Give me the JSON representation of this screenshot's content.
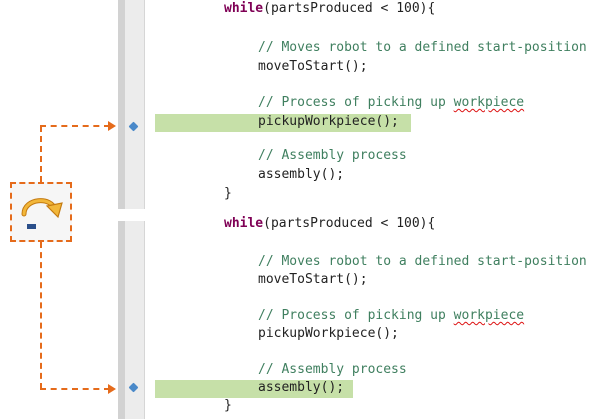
{
  "editor": {
    "top_panel": {
      "lines": [
        {
          "parts": [
            {
              "t": "while",
              "c": "kw"
            },
            {
              "t": "(partsProduced < 100){",
              "c": "plain"
            }
          ]
        },
        {
          "parts": [
            {
              "t": "// Moves robot to a defined start-position",
              "c": "comment"
            }
          ]
        },
        {
          "parts": [
            {
              "t": "moveToStart();",
              "c": "plain"
            }
          ]
        },
        {
          "parts": [
            {
              "t": "// Process of picking up ",
              "c": "comment"
            },
            {
              "t": "workpiece",
              "c": "comment squiggle"
            }
          ]
        },
        {
          "parts": [
            {
              "t": "pickupWorkpiece();",
              "c": "plain"
            }
          ]
        },
        {
          "parts": [
            {
              "t": "// Assembly process",
              "c": "comment"
            }
          ]
        },
        {
          "parts": [
            {
              "t": "assembly();",
              "c": "plain"
            }
          ]
        },
        {
          "parts": [
            {
              "t": "}",
              "c": "plain"
            }
          ]
        }
      ],
      "highlighted_line": "pickupWorkpiece();"
    },
    "bottom_panel": {
      "lines": [
        {
          "parts": [
            {
              "t": "while",
              "c": "kw"
            },
            {
              "t": "(partsProduced < 100){",
              "c": "plain"
            }
          ]
        },
        {
          "parts": [
            {
              "t": "// Moves robot to a defined start-position",
              "c": "comment"
            }
          ]
        },
        {
          "parts": [
            {
              "t": "moveToStart();",
              "c": "plain"
            }
          ]
        },
        {
          "parts": [
            {
              "t": "// Process of picking up ",
              "c": "comment"
            },
            {
              "t": "workpiece",
              "c": "comment squiggle"
            }
          ]
        },
        {
          "parts": [
            {
              "t": "pickupWorkpiece();",
              "c": "plain"
            }
          ]
        },
        {
          "parts": [
            {
              "t": "// Assembly process",
              "c": "comment"
            }
          ]
        },
        {
          "parts": [
            {
              "t": "assembly();",
              "c": "plain"
            }
          ]
        },
        {
          "parts": [
            {
              "t": "}",
              "c": "plain"
            }
          ]
        }
      ],
      "highlighted_line": "assembly();"
    }
  },
  "step_over_button": {
    "icon": "step-over-icon"
  },
  "colors": {
    "keyword": "#7f0055",
    "comment": "#3f7f5f",
    "current_line_highlight": "#c6e0a8",
    "annotation_arrow": "#e56b1b",
    "execution_marker": "#4a89c9"
  }
}
